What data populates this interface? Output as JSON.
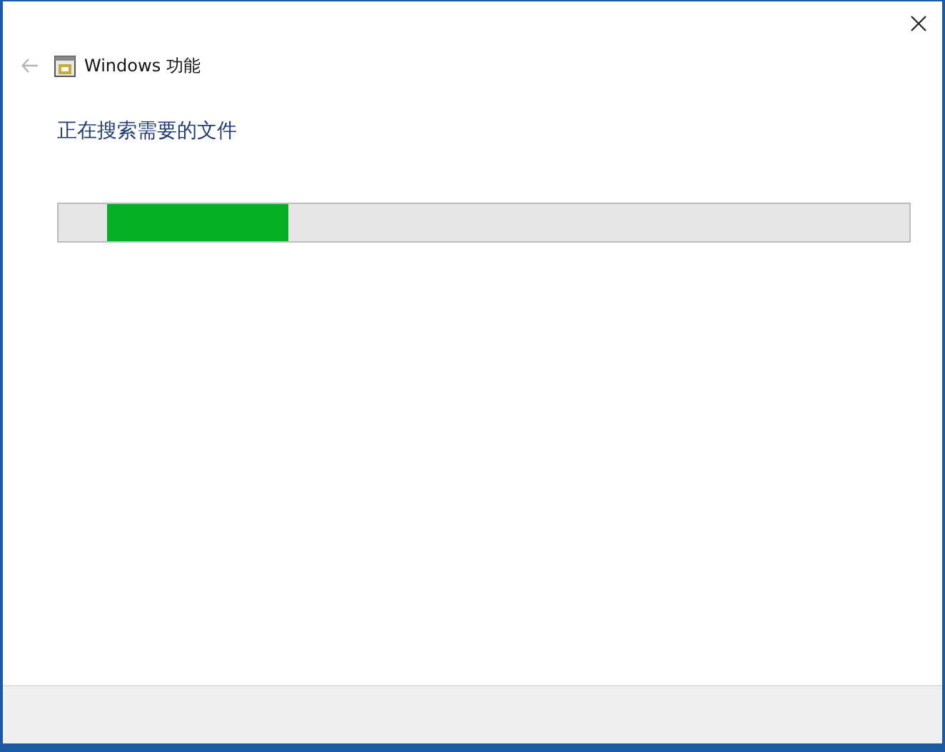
{
  "window": {
    "title": "Windows 功能"
  },
  "status": {
    "text": "正在搜索需要的文件"
  },
  "progress": {
    "kind": "marquee"
  }
}
